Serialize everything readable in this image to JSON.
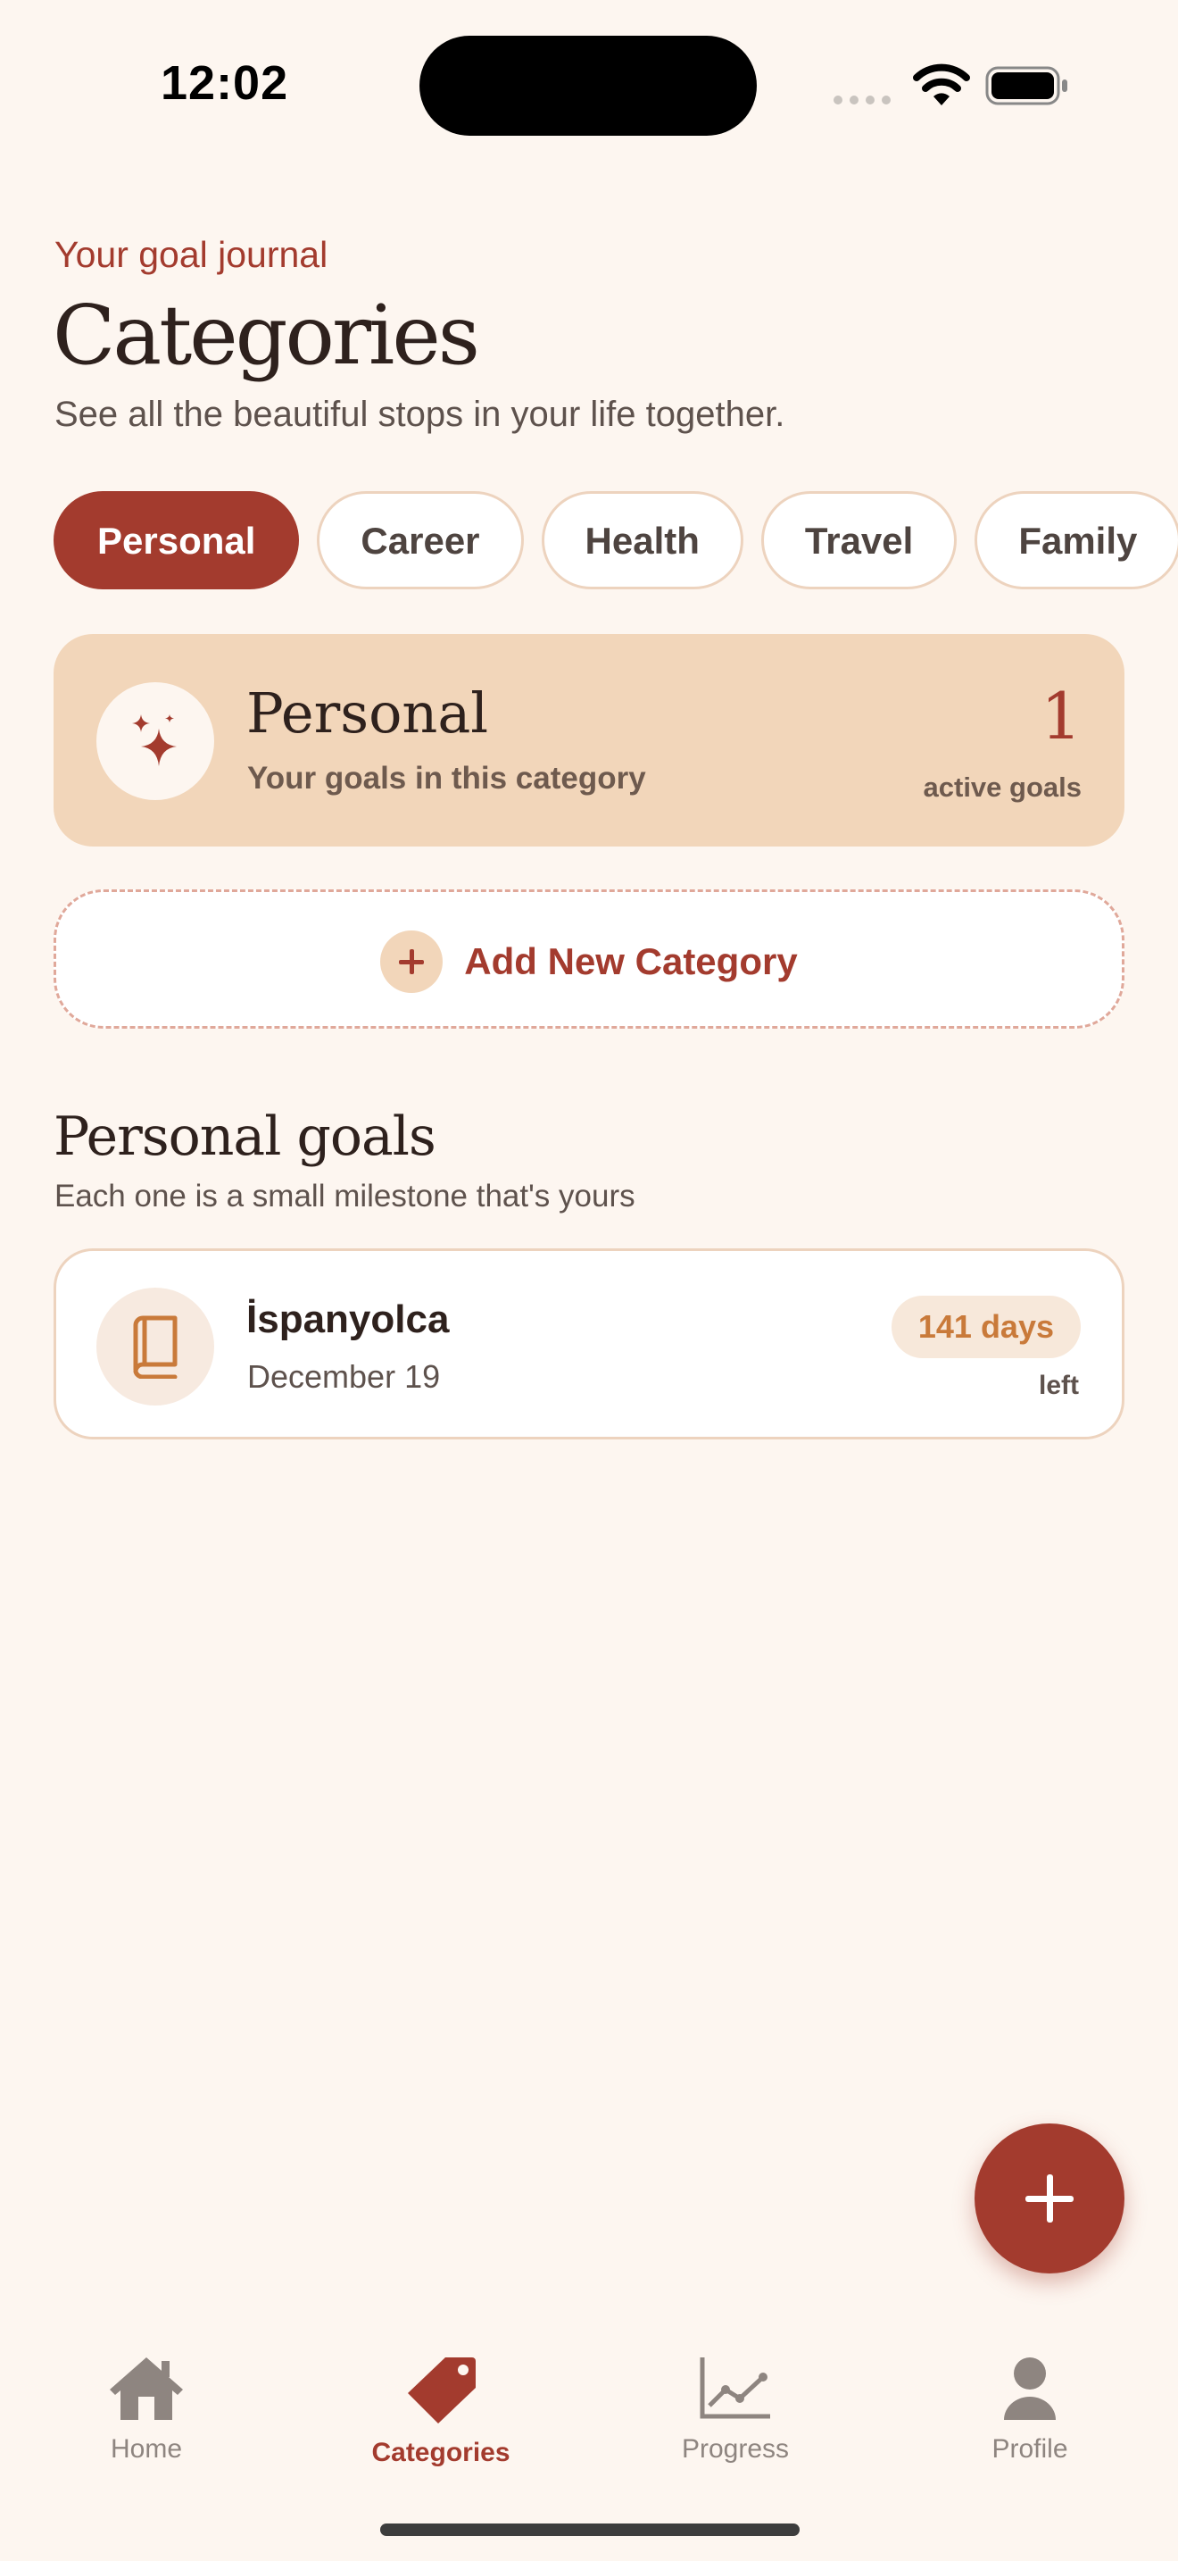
{
  "status_bar": {
    "time": "12:02"
  },
  "header": {
    "eyebrow": "Your goal journal",
    "title": "Categories",
    "subtitle": "See all the beautiful stops in your life together."
  },
  "chips": [
    {
      "label": "Personal",
      "active": true
    },
    {
      "label": "Career",
      "active": false
    },
    {
      "label": "Health",
      "active": false
    },
    {
      "label": "Travel",
      "active": false
    },
    {
      "label": "Family",
      "active": false
    }
  ],
  "category_card": {
    "icon": "sparkle-icon",
    "name": "Personal",
    "description": "Your goals in this category",
    "count": "1",
    "count_label": "active goals"
  },
  "add_category": {
    "label": "Add New Category",
    "icon": "plus-icon"
  },
  "section": {
    "title": "Personal goals",
    "subtitle": "Each one is a small milestone that's yours"
  },
  "goals": [
    {
      "icon": "book-icon",
      "name": "İspanyolca",
      "date": "December 19",
      "days": "141 days",
      "days_suffix": "left"
    }
  ],
  "tabs": [
    {
      "label": "Home",
      "icon": "house-icon",
      "active": false
    },
    {
      "label": "Categories",
      "icon": "tag-icon",
      "active": true
    },
    {
      "label": "Progress",
      "icon": "chart-icon",
      "active": false
    },
    {
      "label": "Profile",
      "icon": "person-icon",
      "active": false
    }
  ],
  "colors": {
    "background": "#FDF6F0",
    "accent": "#A33B2E",
    "card_peach": "#F2D6BA",
    "badge_orange": "#C97A3A"
  }
}
